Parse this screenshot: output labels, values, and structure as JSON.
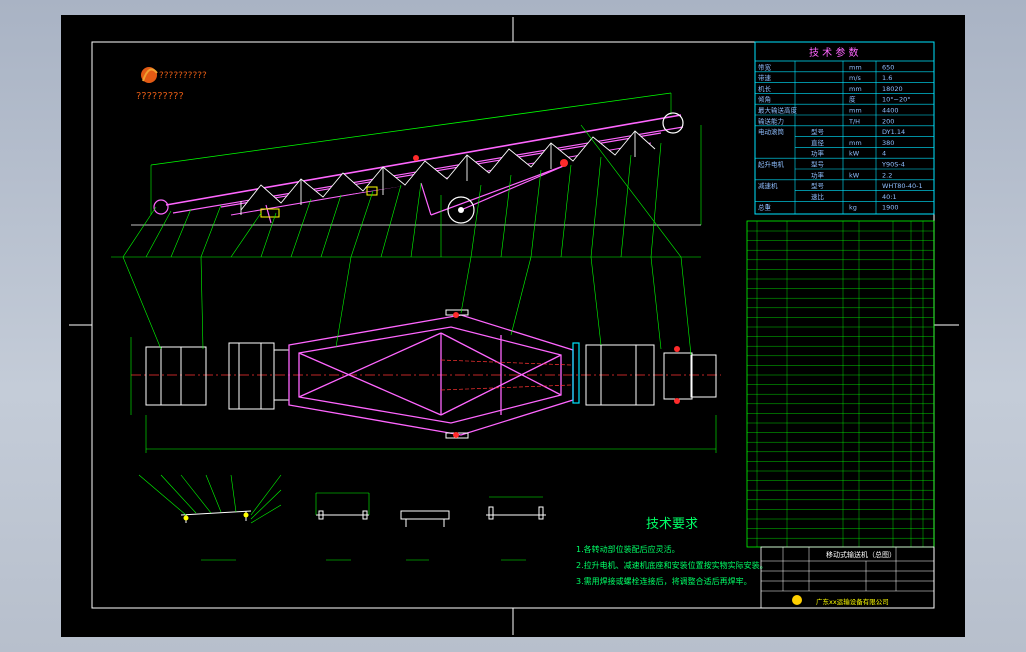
{
  "company": {
    "logo_text": "??????????",
    "subtitle": "?????????"
  },
  "tech_params": {
    "title": "技 术 参 数",
    "rows": [
      {
        "name": "带宽",
        "unit": "mm",
        "value": "650"
      },
      {
        "name": "带速",
        "unit": "m/s",
        "value": "1.6"
      },
      {
        "name": "机长",
        "unit": "mm",
        "value": "18020"
      },
      {
        "name": "倾角",
        "unit": "度",
        "value": "10°~20°"
      },
      {
        "name": "最大输送高度",
        "unit": "mm",
        "value": "4400"
      },
      {
        "name": "输送能力",
        "unit": "T/H",
        "value": "200"
      },
      {
        "group": "电动滚筒",
        "name": "型号",
        "unit": "",
        "value": "DY1.14"
      },
      {
        "group": "",
        "name": "直径",
        "unit": "mm",
        "value": "380"
      },
      {
        "group": "",
        "name": "功率",
        "unit": "kW",
        "value": "4"
      },
      {
        "group": "起升电机",
        "name": "型号",
        "unit": "",
        "value": "Y90S-4"
      },
      {
        "group": "",
        "name": "功率",
        "unit": "kW",
        "value": "2.2"
      },
      {
        "group": "减速机",
        "name": "型号",
        "unit": "",
        "value": "WHT80-40-1"
      },
      {
        "group": "",
        "name": "速比",
        "unit": "",
        "value": "40:1"
      },
      {
        "name": "总重",
        "unit": "kg",
        "value": "1900"
      }
    ]
  },
  "requirements": {
    "title": "技术要求",
    "items": [
      "1.各转动部位装配后应灵活。",
      "2.拉升电机、减速机底座和安装位置按实物实际安装。",
      "3.需用焊接或螺栓连接后，将调整合适后再焊牢。"
    ]
  },
  "title_block": {
    "drawing_name": "移动式输送机（总图）",
    "company_name": "广东xx运输设备有限公司"
  }
}
